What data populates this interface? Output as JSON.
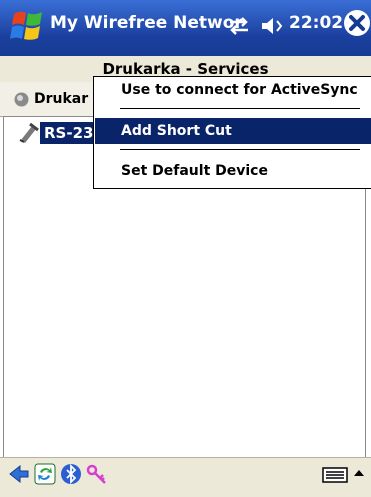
{
  "title_bar": {
    "app_title": "My Wirefree Networ",
    "clock": "22:02",
    "icons": [
      "windows-start-icon",
      "connectivity-icon",
      "volume-icon",
      "close-icon"
    ],
    "colors": {
      "bar": "#1a3f9e",
      "selection": "#0a246a"
    }
  },
  "page_title": "Drukarka - Services",
  "device": {
    "name": "Drukar",
    "icon": "device-status-icon"
  },
  "list": {
    "items": [
      {
        "label": "RS-23",
        "icon": "serial-port-icon",
        "selected": true
      }
    ]
  },
  "context_menu": {
    "items": [
      {
        "label": "Use to connect for ActiveSync",
        "selected": false
      },
      {
        "label": "Add Short Cut",
        "selected": true
      },
      {
        "label": "Set Default Device",
        "selected": false
      }
    ]
  },
  "toolbar": {
    "icons": [
      "back-arrow-icon",
      "refresh-icon",
      "bluetooth-icon",
      "key-icon",
      "keyboard-icon",
      "input-menu-arrow-icon"
    ]
  }
}
